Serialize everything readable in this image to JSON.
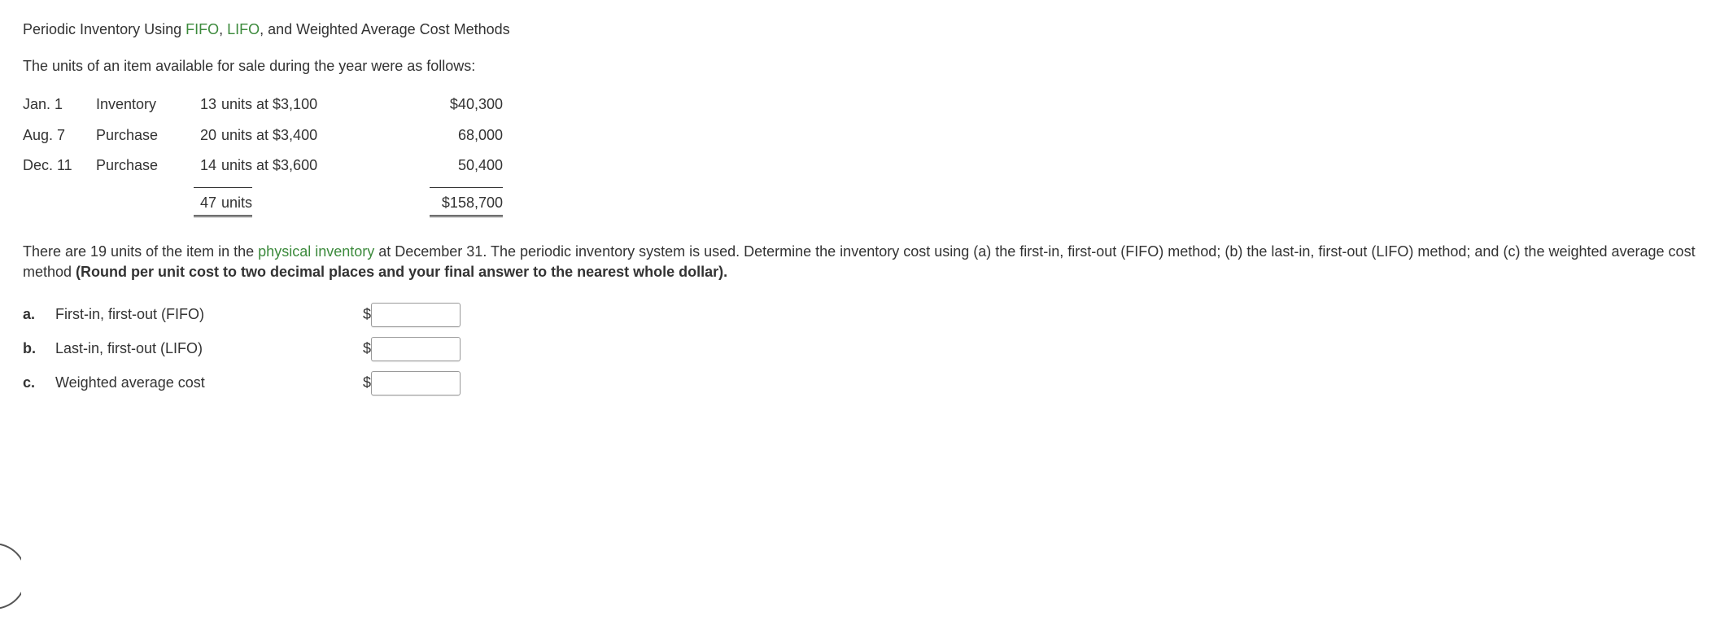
{
  "title": {
    "pre": "Periodic Inventory Using ",
    "fifo": "FIFO",
    "sep1": ", ",
    "lifo": "LIFO",
    "post": ", and Weighted Average Cost Methods"
  },
  "intro": "The units of an item available for sale during the year were as follows:",
  "table": {
    "rows": [
      {
        "date": "Jan. 1",
        "desc": "Inventory",
        "units_num": "13",
        "units_text": "units at $3,100",
        "amount": "$40,300"
      },
      {
        "date": "Aug. 7",
        "desc": "Purchase",
        "units_num": "20",
        "units_text": "units at $3,400",
        "amount": "68,000"
      },
      {
        "date": "Dec. 11",
        "desc": "Purchase",
        "units_num": "14",
        "units_text": "units at $3,600",
        "amount": "50,400"
      }
    ],
    "total": {
      "units_num": "47",
      "units_text": "units",
      "amount": "$158,700"
    }
  },
  "question": {
    "p1a": "There are 19 units of the item in the ",
    "link": "physical inventory",
    "p1b": " at December 31. The periodic inventory system is used. Determine the inventory cost using (a) the first-in, first-out (FIFO) method; (b) the last-in, first-out (LIFO) method; and (c) the weighted average cost method ",
    "bold": "(Round per unit cost to two decimal places and your final answer to the nearest whole dollar)."
  },
  "answers": [
    {
      "letter": "a.",
      "label": "First-in, first-out (FIFO)",
      "currency": "$",
      "value": ""
    },
    {
      "letter": "b.",
      "label": "Last-in, first-out (LIFO)",
      "currency": "$",
      "value": ""
    },
    {
      "letter": "c.",
      "label": "Weighted average cost",
      "currency": "$",
      "value": ""
    }
  ]
}
